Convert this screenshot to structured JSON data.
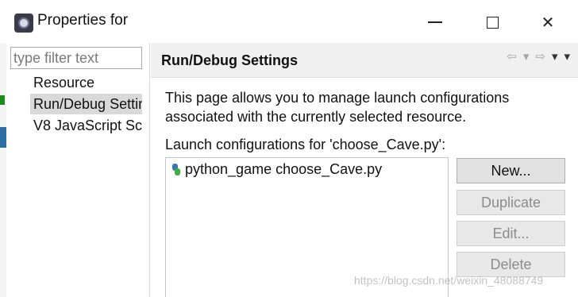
{
  "window": {
    "title": "Properties for",
    "minimize": "minimize",
    "maximize": "maximize",
    "close": "✕"
  },
  "left_panel": {
    "filter_placeholder": "type filter text",
    "items": [
      {
        "label": "Resource"
      },
      {
        "label": "Run/Debug Settings"
      },
      {
        "label": "V8 JavaScript Sc"
      }
    ]
  },
  "header": {
    "heading": "Run/Debug Settings",
    "nav_icons": [
      "back-arrow-icon",
      "dropdown-icon",
      "forward-arrow-icon",
      "dropdown-icon",
      "menu-icon"
    ]
  },
  "main": {
    "description": "This page allows you to manage launch configurations associated with the currently selected resource.",
    "list_label": "Launch configurations for 'choose_Cave.py':",
    "configurations": [
      {
        "label": "python_game choose_Cave.py",
        "icon": "python-launch-icon"
      }
    ],
    "buttons": {
      "new": "New...",
      "duplicate": "Duplicate",
      "edit": "Edit...",
      "delete": "Delete"
    }
  },
  "watermark": "https://blog.csdn.net/weixin_48088749"
}
